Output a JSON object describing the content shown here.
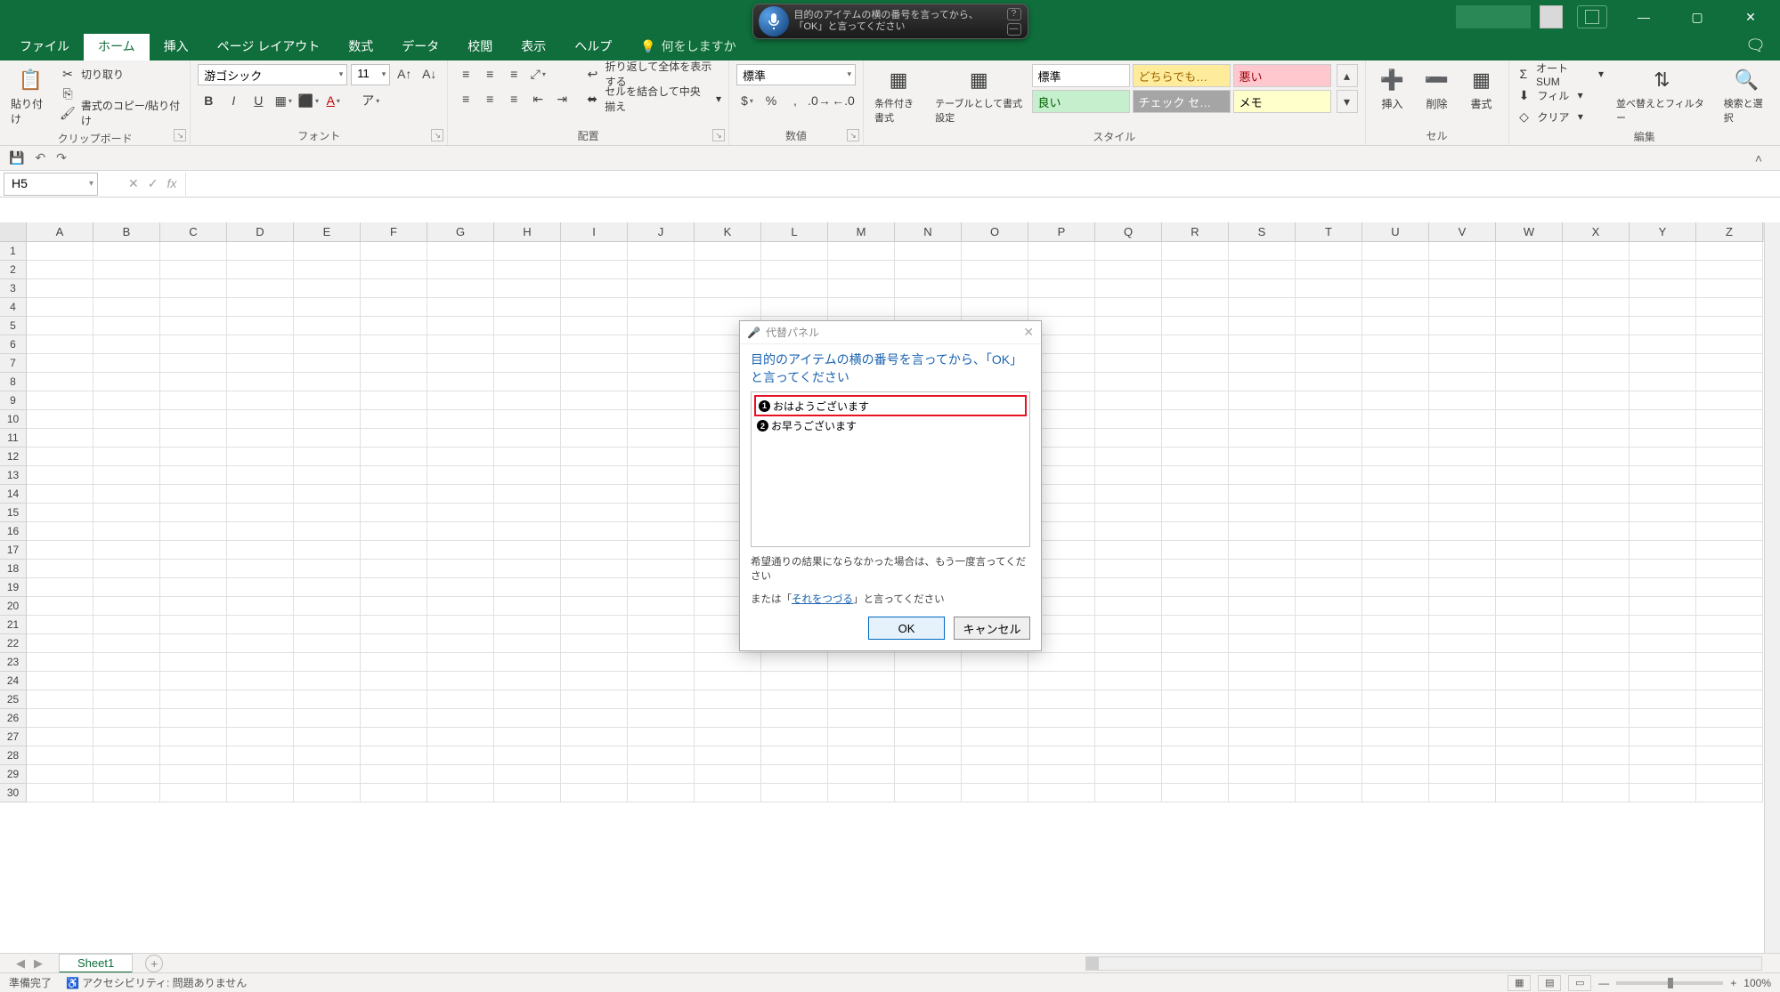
{
  "titlebar": {
    "minimize": "—",
    "maximize": "▢",
    "close": "✕"
  },
  "speech": {
    "text": "目的のアイテムの横の番号を言ってから、「OK」と言ってください"
  },
  "tabs": {
    "file": "ファイル",
    "home": "ホーム",
    "insert": "挿入",
    "pagelayout": "ページ レイアウト",
    "formulas": "数式",
    "data": "データ",
    "review": "校閲",
    "view": "表示",
    "help": "ヘルプ",
    "tellme": "何をしますか"
  },
  "ribbon": {
    "clipboard": {
      "paste": "貼り付け",
      "cut": "切り取り",
      "copy": "書式のコピー/貼り付け",
      "label": "クリップボード"
    },
    "font": {
      "name": "游ゴシック",
      "size": "11",
      "label": "フォント"
    },
    "align": {
      "wrap": "折り返して全体を表示する",
      "merge": "セルを結合して中央揃え",
      "label": "配置"
    },
    "number": {
      "format": "標準",
      "label": "数値"
    },
    "styles": {
      "condfmt": "条件付き書式",
      "tablestyle": "テーブルとして書式設定",
      "normal": "標準",
      "neutral": "どちらでも…",
      "bad": "悪い",
      "good": "良い",
      "check": "チェック セ…",
      "memo": "メモ",
      "label": "スタイル"
    },
    "cells": {
      "insert": "挿入",
      "delete": "削除",
      "format": "書式",
      "label": "セル"
    },
    "editing": {
      "autosum": "オート SUM",
      "fill": "フィル",
      "clear": "クリア",
      "sort": "並べ替えとフィルター",
      "find": "検索と選択",
      "label": "編集"
    }
  },
  "qat": {
    "save": "💾",
    "undo": "↶",
    "redo": "↷"
  },
  "namebox": "H5",
  "columns": [
    "A",
    "B",
    "C",
    "D",
    "E",
    "F",
    "G",
    "H",
    "I",
    "J",
    "K",
    "L",
    "M",
    "N",
    "O",
    "P",
    "Q",
    "R",
    "S",
    "T",
    "U",
    "V",
    "W",
    "X",
    "Y",
    "Z"
  ],
  "rows_count": 30,
  "sheet": {
    "name": "Sheet1",
    "add": "+"
  },
  "status": {
    "ready": "準備完了",
    "a11y": "アクセシビリティ: 問題ありません",
    "zoom": "100%"
  },
  "dialog": {
    "title": "代替パネル",
    "instruction": "目的のアイテムの横の番号を言ってから、「OK」と言ってください",
    "items": [
      "おはようございます",
      "お早うございます"
    ],
    "note1": "希望通りの結果にならなかった場合は、もう一度言ってください",
    "note2_pre": "または「",
    "note2_link": "それをつづる",
    "note2_post": "」と言ってください",
    "ok": "OK",
    "cancel": "キャンセル"
  }
}
